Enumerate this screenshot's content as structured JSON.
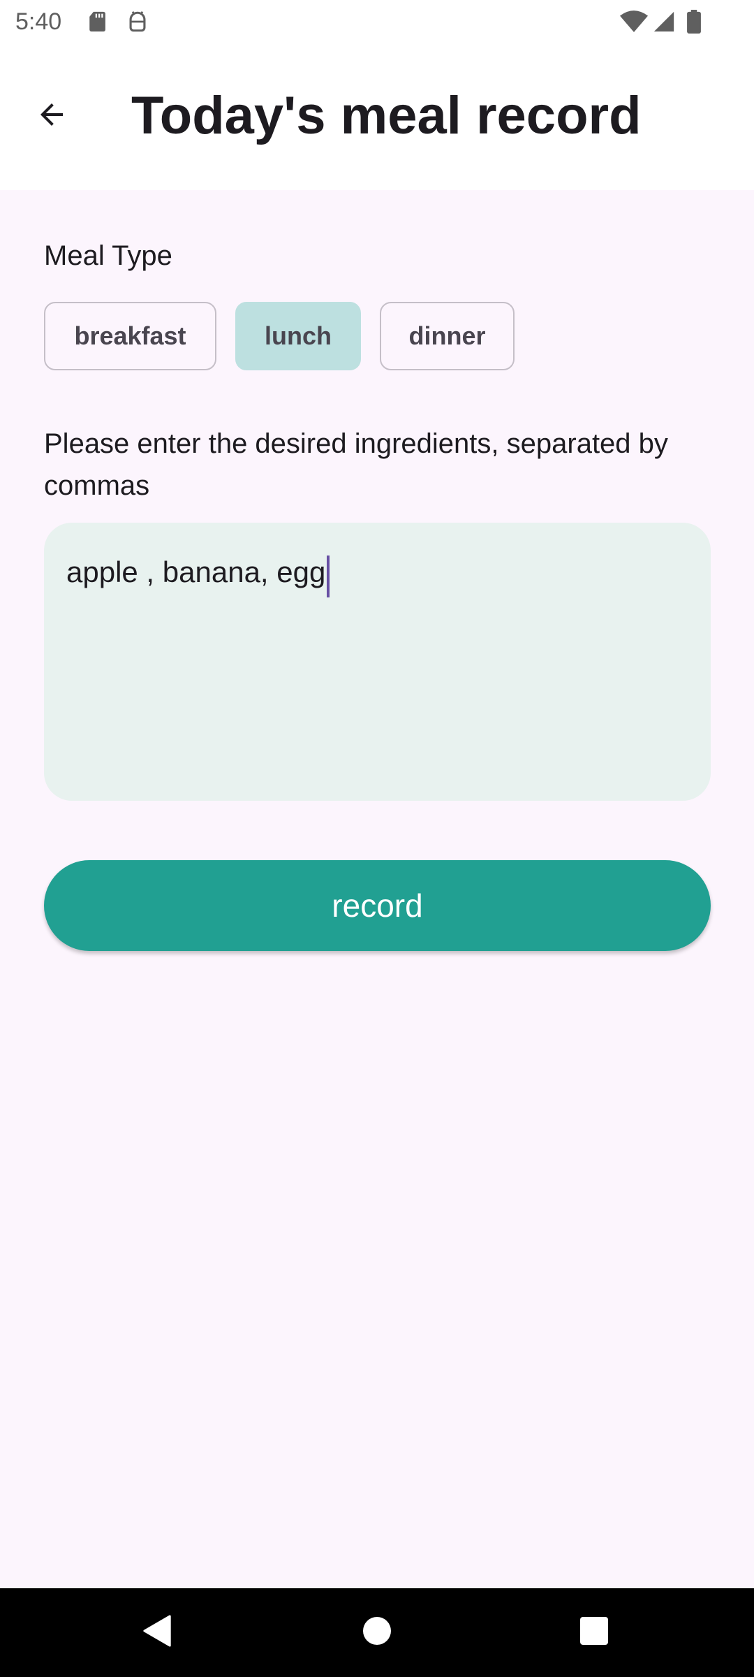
{
  "status_bar": {
    "time": "5:40",
    "left_icons": [
      "sd-card-icon",
      "android-debug-icon"
    ],
    "right_icons": [
      "wifi-icon",
      "cellular-signal-icon",
      "battery-icon"
    ]
  },
  "app_bar": {
    "back_icon": "arrow-back-icon",
    "title": "Today's meal record"
  },
  "meal_type": {
    "label": "Meal Type",
    "options": [
      "breakfast",
      "lunch",
      "dinner"
    ],
    "selected": "lunch"
  },
  "ingredients": {
    "label": "Please enter the desired ingredients, separated by commas",
    "value": "apple , banana, egg"
  },
  "record_button": {
    "label": "record"
  },
  "nav_bar": {
    "buttons": [
      "back-triangle-icon",
      "home-circle-icon",
      "recents-square-icon"
    ]
  },
  "colors": {
    "background": "#fcf5fd",
    "chip_selected": "#bde0e0",
    "field_background": "#e8f2ef",
    "primary_button": "#21a092",
    "caret": "#6750a4"
  }
}
